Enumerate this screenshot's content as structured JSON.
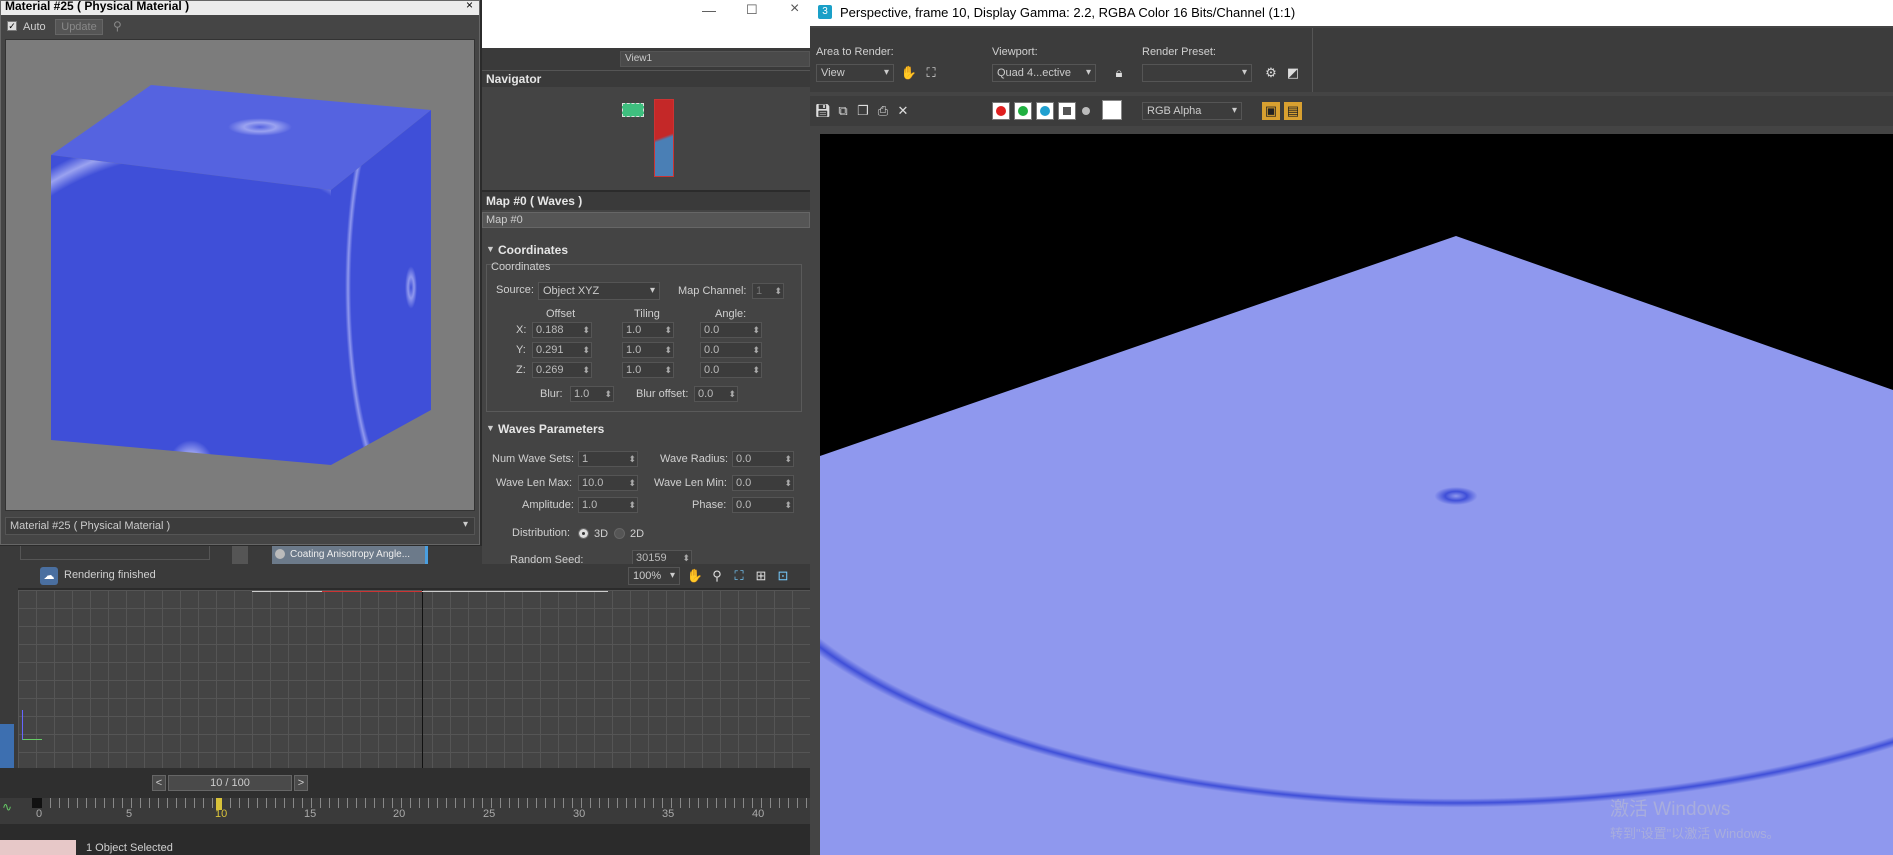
{
  "material_editor": {
    "title": "Material #25  ( Physical Material )",
    "auto_label": "Auto",
    "update_label": "Update",
    "bottom_label": "Material #25  ( Physical Material )"
  },
  "slate": {
    "view_dropdown": "View1",
    "navigator_title": "Navigator",
    "map_title": "Map #0  ( Waves )",
    "map_name": "Map #0",
    "coords_section": "Coordinates",
    "coords_sub": "Coordinates",
    "source_label": "Source:",
    "source_value": "Object XYZ",
    "map_channel_label": "Map Channel:",
    "map_channel_value": "1",
    "offset_label": "Offset",
    "tiling_label": "Tiling",
    "angle_label": "Angle:",
    "x_label": "X:",
    "y_label": "Y:",
    "z_label": "Z:",
    "offset": [
      "0.188",
      "0.291",
      "0.269"
    ],
    "tiling": [
      "1.0",
      "1.0",
      "1.0"
    ],
    "angle": [
      "0.0",
      "0.0",
      "0.0"
    ],
    "blur_label": "Blur:",
    "blur_value": "1.0",
    "blur_offset_label": "Blur offset:",
    "blur_offset_value": "0.0",
    "waves_section": "Waves Parameters",
    "num_wave_sets_label": "Num Wave Sets:",
    "num_wave_sets_value": "1",
    "wave_radius_label": "Wave Radius:",
    "wave_radius_value": "0.0",
    "wave_len_max_label": "Wave Len Max:",
    "wave_len_max_value": "10.0",
    "wave_len_min_label": "Wave Len Min:",
    "wave_len_min_value": "0.0",
    "amplitude_label": "Amplitude:",
    "amplitude_value": "1.0",
    "phase_label": "Phase:",
    "phase_value": "0.0",
    "distribution_label": "Distribution:",
    "dist_3d": "3D",
    "dist_2d": "2D",
    "random_seed_label": "Random Seed:",
    "random_seed_value": "30159",
    "node_label": "Coating Anisotropy Angle...",
    "status_text": "Rendering finished",
    "zoom_value": "100%"
  },
  "timeline": {
    "frame_display": "10 / 100",
    "prev": "<",
    "next": ">",
    "ticks": [
      "0",
      "5",
      "10",
      "15",
      "20",
      "25",
      "30",
      "35",
      "40"
    ],
    "status": "1 Object Selected"
  },
  "render_window": {
    "title": "Perspective, frame 10, Display Gamma: 2.2, RGBA Color 16 Bits/Channel (1:1)",
    "area_label": "Area to Render:",
    "area_value": "View",
    "viewport_label": "Viewport:",
    "viewport_value": "Quad 4...ective",
    "preset_label": "Render Preset:",
    "preset_value": "",
    "channel_value": "RGB Alpha"
  },
  "watermark": {
    "line1": "激活 Windows",
    "line2": "转到\"设置\"以激活 Windows。"
  },
  "colors": {
    "wave_blue": "#3f4fd8",
    "wave_light": "#8f98ee",
    "panel_bg": "#444444",
    "dark_bg": "#2b2b2b"
  }
}
